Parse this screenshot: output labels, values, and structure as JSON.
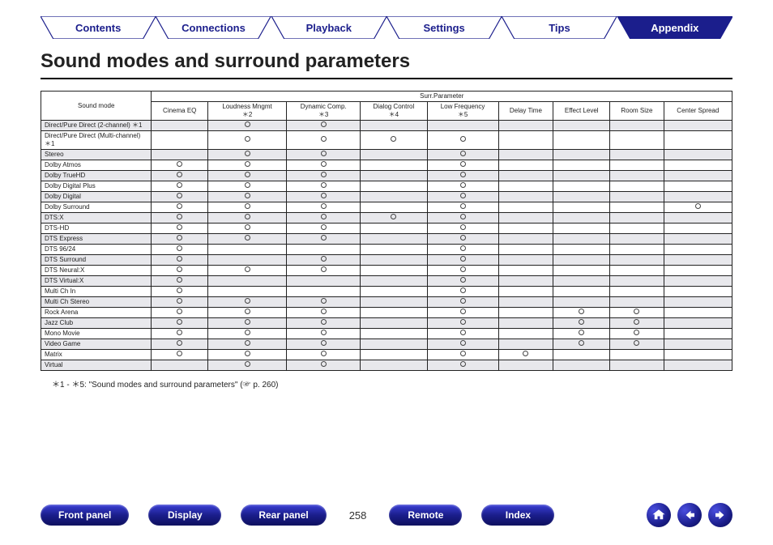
{
  "tabs": {
    "contents": "Contents",
    "connections": "Connections",
    "playback": "Playback",
    "settings": "Settings",
    "tips": "Tips",
    "appendix": "Appendix"
  },
  "title": "Sound modes and surround parameters",
  "table": {
    "soundModeHeader": "Sound mode",
    "surrParamHeader": "Surr.Parameter",
    "columns": [
      {
        "label": "Cinema EQ",
        "note": ""
      },
      {
        "label": "Loudness Mngmt",
        "note": "＊2"
      },
      {
        "label": "Dynamic Comp.",
        "note": "＊3"
      },
      {
        "label": "Dialog Control",
        "note": "＊4"
      },
      {
        "label": "Low Frequency",
        "note": "＊5"
      },
      {
        "label": "Delay Time",
        "note": ""
      },
      {
        "label": "Effect Level",
        "note": ""
      },
      {
        "label": "Room Size",
        "note": ""
      },
      {
        "label": "Center Spread",
        "note": ""
      }
    ],
    "rows": [
      {
        "mode": "Direct/Pure Direct (2-channel) ＊1",
        "v": [
          0,
          1,
          1,
          0,
          0,
          0,
          0,
          0,
          0
        ]
      },
      {
        "mode": "Direct/Pure Direct (Multi-channel) ＊1",
        "v": [
          0,
          1,
          1,
          1,
          1,
          0,
          0,
          0,
          0
        ]
      },
      {
        "mode": "Stereo",
        "v": [
          0,
          1,
          1,
          0,
          1,
          0,
          0,
          0,
          0
        ]
      },
      {
        "mode": "Dolby Atmos",
        "v": [
          1,
          1,
          1,
          0,
          1,
          0,
          0,
          0,
          0
        ]
      },
      {
        "mode": "Dolby TrueHD",
        "v": [
          1,
          1,
          1,
          0,
          1,
          0,
          0,
          0,
          0
        ]
      },
      {
        "mode": "Dolby Digital Plus",
        "v": [
          1,
          1,
          1,
          0,
          1,
          0,
          0,
          0,
          0
        ]
      },
      {
        "mode": "Dolby Digital",
        "v": [
          1,
          1,
          1,
          0,
          1,
          0,
          0,
          0,
          0
        ]
      },
      {
        "mode": "Dolby Surround",
        "v": [
          1,
          1,
          1,
          0,
          1,
          0,
          0,
          0,
          1
        ]
      },
      {
        "mode": "DTS:X",
        "v": [
          1,
          1,
          1,
          1,
          1,
          0,
          0,
          0,
          0
        ]
      },
      {
        "mode": "DTS-HD",
        "v": [
          1,
          1,
          1,
          0,
          1,
          0,
          0,
          0,
          0
        ]
      },
      {
        "mode": "DTS Express",
        "v": [
          1,
          1,
          1,
          0,
          1,
          0,
          0,
          0,
          0
        ]
      },
      {
        "mode": "DTS 96/24",
        "v": [
          1,
          0,
          0,
          0,
          1,
          0,
          0,
          0,
          0
        ]
      },
      {
        "mode": "DTS Surround",
        "v": [
          1,
          0,
          1,
          0,
          1,
          0,
          0,
          0,
          0
        ]
      },
      {
        "mode": "DTS Neural:X",
        "v": [
          1,
          1,
          1,
          0,
          1,
          0,
          0,
          0,
          0
        ]
      },
      {
        "mode": "DTS Virtual:X",
        "v": [
          1,
          0,
          0,
          0,
          1,
          0,
          0,
          0,
          0
        ]
      },
      {
        "mode": "Multi Ch In",
        "v": [
          1,
          0,
          0,
          0,
          1,
          0,
          0,
          0,
          0
        ]
      },
      {
        "mode": "Multi Ch Stereo",
        "v": [
          1,
          1,
          1,
          0,
          1,
          0,
          0,
          0,
          0
        ]
      },
      {
        "mode": "Rock Arena",
        "v": [
          1,
          1,
          1,
          0,
          1,
          0,
          1,
          1,
          0
        ]
      },
      {
        "mode": "Jazz Club",
        "v": [
          1,
          1,
          1,
          0,
          1,
          0,
          1,
          1,
          0
        ]
      },
      {
        "mode": "Mono Movie",
        "v": [
          1,
          1,
          1,
          0,
          1,
          0,
          1,
          1,
          0
        ]
      },
      {
        "mode": "Video Game",
        "v": [
          1,
          1,
          1,
          0,
          1,
          0,
          1,
          1,
          0
        ]
      },
      {
        "mode": "Matrix",
        "v": [
          1,
          1,
          1,
          0,
          1,
          1,
          0,
          0,
          0
        ]
      },
      {
        "mode": "Virtual",
        "v": [
          0,
          1,
          1,
          0,
          1,
          0,
          0,
          0,
          0
        ]
      }
    ]
  },
  "footnote": "＊1 - ＊5: \"Sound modes and surround parameters\" (☞ p. 260)",
  "bottom": {
    "front": "Front panel",
    "display": "Display",
    "rear": "Rear panel",
    "remote": "Remote",
    "index": "Index",
    "page": "258"
  }
}
